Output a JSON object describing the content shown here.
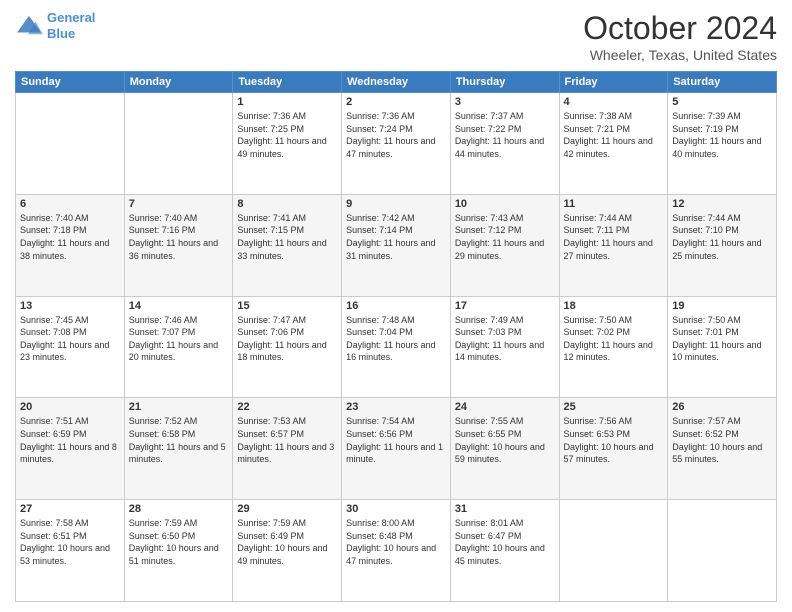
{
  "header": {
    "logo_line1": "General",
    "logo_line2": "Blue",
    "month_title": "October 2024",
    "subtitle": "Wheeler, Texas, United States"
  },
  "weekdays": [
    "Sunday",
    "Monday",
    "Tuesday",
    "Wednesday",
    "Thursday",
    "Friday",
    "Saturday"
  ],
  "weeks": [
    [
      {
        "day": "",
        "info": ""
      },
      {
        "day": "",
        "info": ""
      },
      {
        "day": "1",
        "info": "Sunrise: 7:36 AM\nSunset: 7:25 PM\nDaylight: 11 hours and 49 minutes."
      },
      {
        "day": "2",
        "info": "Sunrise: 7:36 AM\nSunset: 7:24 PM\nDaylight: 11 hours and 47 minutes."
      },
      {
        "day": "3",
        "info": "Sunrise: 7:37 AM\nSunset: 7:22 PM\nDaylight: 11 hours and 44 minutes."
      },
      {
        "day": "4",
        "info": "Sunrise: 7:38 AM\nSunset: 7:21 PM\nDaylight: 11 hours and 42 minutes."
      },
      {
        "day": "5",
        "info": "Sunrise: 7:39 AM\nSunset: 7:19 PM\nDaylight: 11 hours and 40 minutes."
      }
    ],
    [
      {
        "day": "6",
        "info": "Sunrise: 7:40 AM\nSunset: 7:18 PM\nDaylight: 11 hours and 38 minutes."
      },
      {
        "day": "7",
        "info": "Sunrise: 7:40 AM\nSunset: 7:16 PM\nDaylight: 11 hours and 36 minutes."
      },
      {
        "day": "8",
        "info": "Sunrise: 7:41 AM\nSunset: 7:15 PM\nDaylight: 11 hours and 33 minutes."
      },
      {
        "day": "9",
        "info": "Sunrise: 7:42 AM\nSunset: 7:14 PM\nDaylight: 11 hours and 31 minutes."
      },
      {
        "day": "10",
        "info": "Sunrise: 7:43 AM\nSunset: 7:12 PM\nDaylight: 11 hours and 29 minutes."
      },
      {
        "day": "11",
        "info": "Sunrise: 7:44 AM\nSunset: 7:11 PM\nDaylight: 11 hours and 27 minutes."
      },
      {
        "day": "12",
        "info": "Sunrise: 7:44 AM\nSunset: 7:10 PM\nDaylight: 11 hours and 25 minutes."
      }
    ],
    [
      {
        "day": "13",
        "info": "Sunrise: 7:45 AM\nSunset: 7:08 PM\nDaylight: 11 hours and 23 minutes."
      },
      {
        "day": "14",
        "info": "Sunrise: 7:46 AM\nSunset: 7:07 PM\nDaylight: 11 hours and 20 minutes."
      },
      {
        "day": "15",
        "info": "Sunrise: 7:47 AM\nSunset: 7:06 PM\nDaylight: 11 hours and 18 minutes."
      },
      {
        "day": "16",
        "info": "Sunrise: 7:48 AM\nSunset: 7:04 PM\nDaylight: 11 hours and 16 minutes."
      },
      {
        "day": "17",
        "info": "Sunrise: 7:49 AM\nSunset: 7:03 PM\nDaylight: 11 hours and 14 minutes."
      },
      {
        "day": "18",
        "info": "Sunrise: 7:50 AM\nSunset: 7:02 PM\nDaylight: 11 hours and 12 minutes."
      },
      {
        "day": "19",
        "info": "Sunrise: 7:50 AM\nSunset: 7:01 PM\nDaylight: 11 hours and 10 minutes."
      }
    ],
    [
      {
        "day": "20",
        "info": "Sunrise: 7:51 AM\nSunset: 6:59 PM\nDaylight: 11 hours and 8 minutes."
      },
      {
        "day": "21",
        "info": "Sunrise: 7:52 AM\nSunset: 6:58 PM\nDaylight: 11 hours and 5 minutes."
      },
      {
        "day": "22",
        "info": "Sunrise: 7:53 AM\nSunset: 6:57 PM\nDaylight: 11 hours and 3 minutes."
      },
      {
        "day": "23",
        "info": "Sunrise: 7:54 AM\nSunset: 6:56 PM\nDaylight: 11 hours and 1 minute."
      },
      {
        "day": "24",
        "info": "Sunrise: 7:55 AM\nSunset: 6:55 PM\nDaylight: 10 hours and 59 minutes."
      },
      {
        "day": "25",
        "info": "Sunrise: 7:56 AM\nSunset: 6:53 PM\nDaylight: 10 hours and 57 minutes."
      },
      {
        "day": "26",
        "info": "Sunrise: 7:57 AM\nSunset: 6:52 PM\nDaylight: 10 hours and 55 minutes."
      }
    ],
    [
      {
        "day": "27",
        "info": "Sunrise: 7:58 AM\nSunset: 6:51 PM\nDaylight: 10 hours and 53 minutes."
      },
      {
        "day": "28",
        "info": "Sunrise: 7:59 AM\nSunset: 6:50 PM\nDaylight: 10 hours and 51 minutes."
      },
      {
        "day": "29",
        "info": "Sunrise: 7:59 AM\nSunset: 6:49 PM\nDaylight: 10 hours and 49 minutes."
      },
      {
        "day": "30",
        "info": "Sunrise: 8:00 AM\nSunset: 6:48 PM\nDaylight: 10 hours and 47 minutes."
      },
      {
        "day": "31",
        "info": "Sunrise: 8:01 AM\nSunset: 6:47 PM\nDaylight: 10 hours and 45 minutes."
      },
      {
        "day": "",
        "info": ""
      },
      {
        "day": "",
        "info": ""
      }
    ]
  ]
}
